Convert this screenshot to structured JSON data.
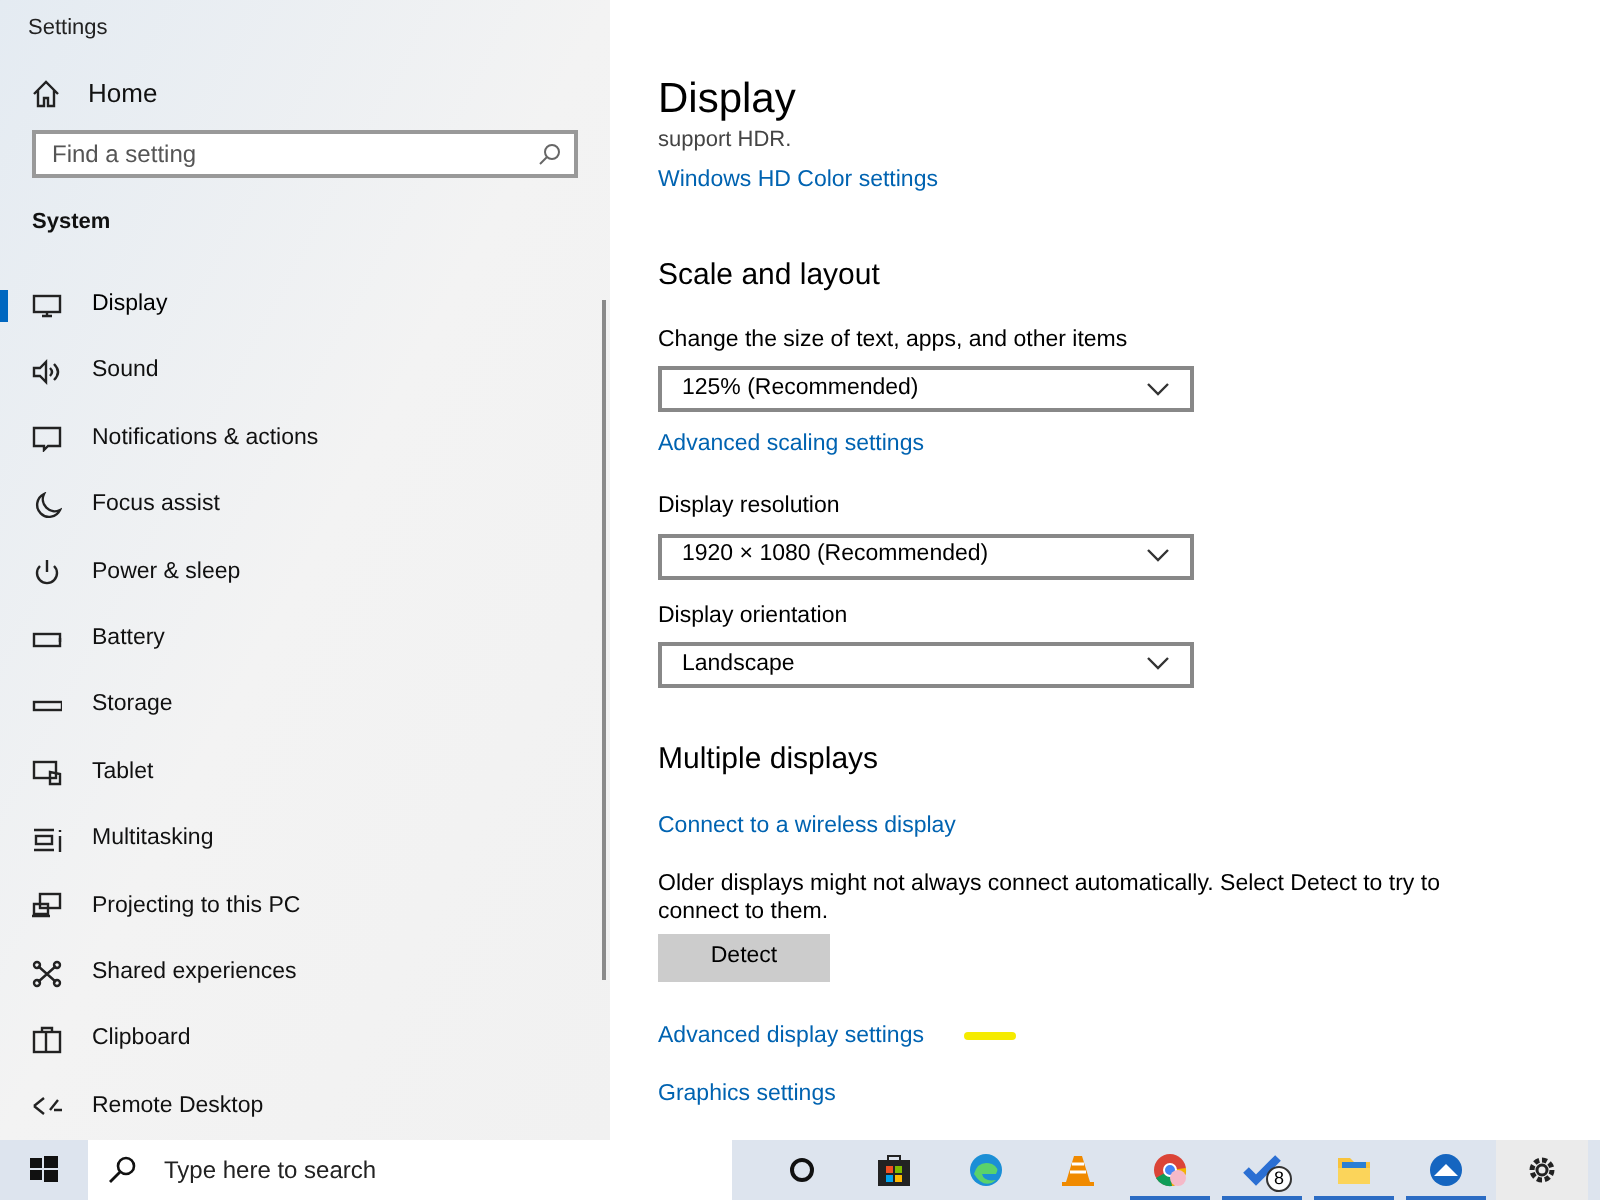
{
  "window": {
    "title": "Settings"
  },
  "sidebar": {
    "home": "Home",
    "search": {
      "placeholder": "Find a setting"
    },
    "section": "System",
    "items": [
      {
        "label": "Display",
        "kind": "display",
        "selected": true
      },
      {
        "label": "Sound",
        "kind": "sound",
        "selected": false
      },
      {
        "label": "Notifications & actions",
        "kind": "notifications",
        "selected": false
      },
      {
        "label": "Focus assist",
        "kind": "moon",
        "selected": false
      },
      {
        "label": "Power & sleep",
        "kind": "power",
        "selected": false
      },
      {
        "label": "Battery",
        "kind": "battery",
        "selected": false
      },
      {
        "label": "Storage",
        "kind": "storage",
        "selected": false
      },
      {
        "label": "Tablet",
        "kind": "tablet",
        "selected": false
      },
      {
        "label": "Multitasking",
        "kind": "multitasking",
        "selected": false
      },
      {
        "label": "Projecting to this PC",
        "kind": "projecting",
        "selected": false
      },
      {
        "label": "Shared experiences",
        "kind": "shared",
        "selected": false
      },
      {
        "label": "Clipboard",
        "kind": "clipboard",
        "selected": false
      },
      {
        "label": "Remote Desktop",
        "kind": "remote",
        "selected": false
      }
    ]
  },
  "content": {
    "title": "Display",
    "clipped_text": "support HDR.",
    "hdr_link": "Windows HD Color settings",
    "scale": {
      "heading": "Scale and layout",
      "fields": [
        {
          "label": "Change the size of text, apps, and other items",
          "value": "125% (Recommended)",
          "link": "Advanced scaling settings"
        },
        {
          "label": "Display resolution",
          "value": "1920 × 1080 (Recommended)"
        },
        {
          "label": "Display orientation",
          "value": "Landscape"
        }
      ]
    },
    "multiple": {
      "heading": "Multiple displays",
      "link": "Connect to a wireless display",
      "text": "Older displays might not always connect automatically. Select Detect to try to connect to them.",
      "button": "Detect"
    },
    "links": [
      "Advanced display settings",
      "Graphics settings"
    ]
  },
  "taskbar": {
    "search_placeholder": "Type here to search",
    "apps": [
      {
        "kind": "cortana",
        "running": false
      },
      {
        "kind": "store",
        "running": false
      },
      {
        "kind": "edge",
        "running": false
      },
      {
        "kind": "vlc",
        "running": false
      },
      {
        "kind": "chrome",
        "running": true
      },
      {
        "kind": "todo",
        "running": true,
        "badge": "8"
      },
      {
        "kind": "explorer",
        "running": true
      },
      {
        "kind": "app",
        "running": true
      },
      {
        "kind": "settings",
        "running": false
      }
    ]
  }
}
